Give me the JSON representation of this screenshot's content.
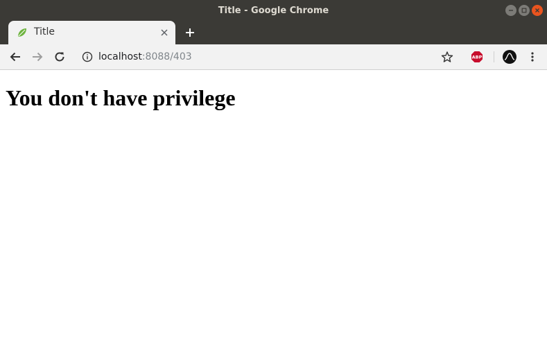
{
  "window": {
    "title": "Title - Google Chrome"
  },
  "tabs": [
    {
      "title": "Title",
      "favicon": "spring-leaf-icon",
      "active": true
    }
  ],
  "address_bar": {
    "host": "localhost",
    "rest": ":8088/403"
  },
  "extensions": [
    {
      "name": "adblock-plus-icon",
      "label": "ABP"
    },
    {
      "name": "extension-wave-icon"
    }
  ],
  "page": {
    "heading": "You don't have privilege"
  },
  "colors": {
    "titlebar": "#3b3a36",
    "toolbar": "#f2f2f2",
    "close_button": "#e9541f",
    "abp_red": "#c70d2c",
    "leaf_green": "#6db33f"
  }
}
